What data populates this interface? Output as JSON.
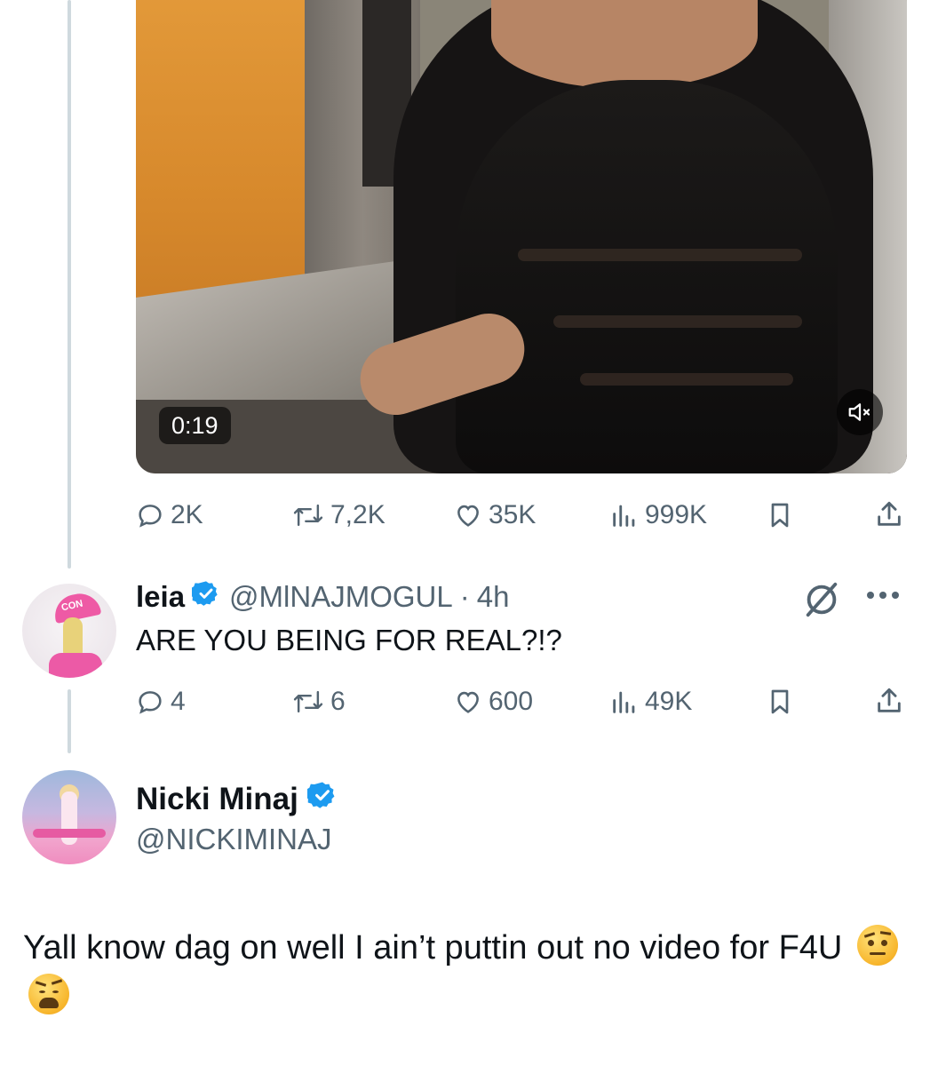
{
  "video": {
    "duration": "0:19",
    "mute_icon": "mute-icon"
  },
  "first_tweet_actions": {
    "replies": "2K",
    "reposts": "7,2K",
    "likes": "35K",
    "views": "999K"
  },
  "reply": {
    "name": "leia",
    "handle": "@MlNAJMOGUL",
    "separator": "·",
    "time": "4h",
    "text": "ARE YOU BEING FOR REAL?!?",
    "avatar_cap_text": "CON",
    "actions": {
      "replies": "4",
      "reposts": "6",
      "likes": "600",
      "views": "49K"
    }
  },
  "main_tweet": {
    "name": "Nicki Minaj",
    "handle": "@NICKIMINAJ",
    "text": "Yall know dag on well I ain’t puttin out no video for F4U",
    "emojis": [
      "raised-eyebrow-emoji",
      "weary-face-emoji"
    ]
  },
  "colors": {
    "text_primary": "#0f1419",
    "text_secondary": "#536471",
    "verified_blue": "#1d9bf0",
    "thread_line": "#cfd9de"
  }
}
